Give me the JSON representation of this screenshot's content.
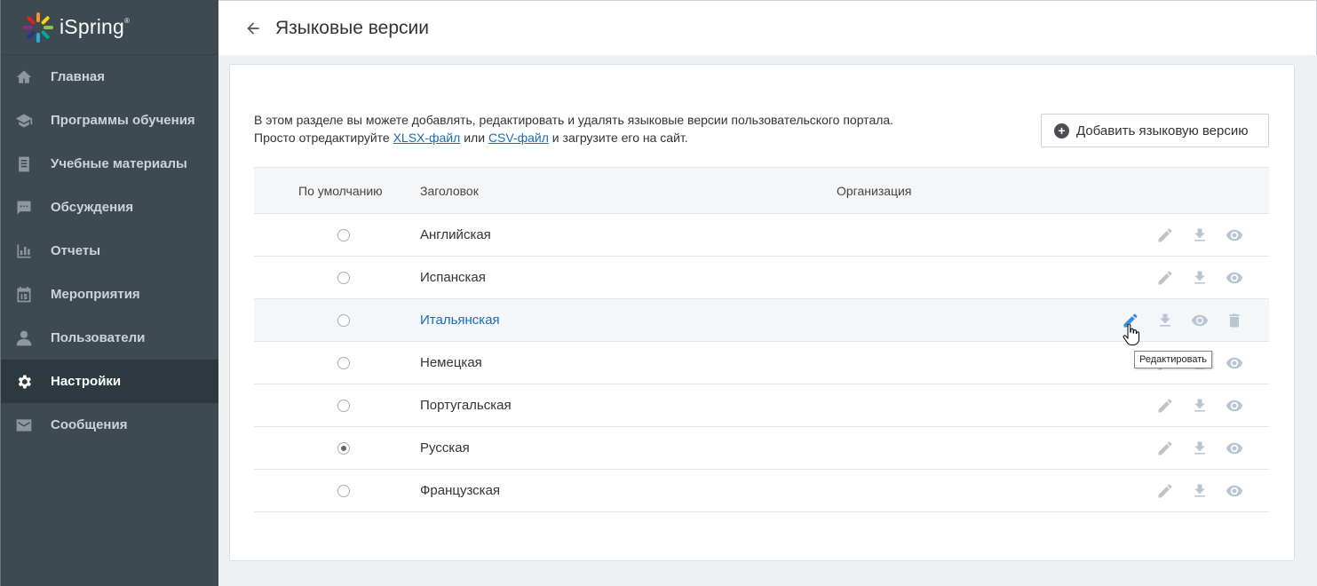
{
  "brand": {
    "name": "iSpring",
    "mark": "®"
  },
  "sidebar": {
    "items": [
      {
        "label": "Главная",
        "icon": "home-icon",
        "active": false
      },
      {
        "label": "Программы обучения",
        "icon": "graduation-cap-icon",
        "active": false
      },
      {
        "label": "Учебные материалы",
        "icon": "document-list-icon",
        "active": false
      },
      {
        "label": "Обсуждения",
        "icon": "chat-bubble-icon",
        "active": false
      },
      {
        "label": "Отчеты",
        "icon": "bar-chart-icon",
        "active": false
      },
      {
        "label": "Мероприятия",
        "icon": "calendar-icon",
        "active": false
      },
      {
        "label": "Пользователи",
        "icon": "user-icon",
        "active": false
      },
      {
        "label": "Настройки",
        "icon": "gear-icon",
        "active": true
      },
      {
        "label": "Сообщения",
        "icon": "envelope-icon",
        "active": false
      }
    ]
  },
  "header": {
    "title": "Языковые версии"
  },
  "intro": {
    "line1": "В этом разделе вы можете добавлять, редактировать и удалять языковые версии пользовательского портала.",
    "line2_prefix": "Просто отредактируйте ",
    "xlsx_link": "XLSX-файл",
    "or": " или ",
    "csv_link": "CSV-файл",
    "line2_suffix": " и загрузите его на сайт."
  },
  "add_button": {
    "label": "Добавить языковую версию"
  },
  "table": {
    "columns": {
      "default": "По умолчанию",
      "title": "Заголовок",
      "org": "Организация"
    },
    "rows": [
      {
        "title": "Английская",
        "default": false,
        "hover": false
      },
      {
        "title": "Испанская",
        "default": false,
        "hover": false
      },
      {
        "title": "Итальянская",
        "default": false,
        "hover": true
      },
      {
        "title": "Немецкая",
        "default": false,
        "hover": false
      },
      {
        "title": "Португальская",
        "default": false,
        "hover": false
      },
      {
        "title": "Русская",
        "default": true,
        "hover": false
      },
      {
        "title": "Французская",
        "default": false,
        "hover": false
      }
    ]
  },
  "tooltip": {
    "text": "Редактировать"
  },
  "colors": {
    "sidebar": "#3d4a52",
    "sidebar_active": "#2e383f",
    "link": "#1a6bb5",
    "icon_muted": "#b9c6d2",
    "icon_active": "#3a8fd4"
  }
}
